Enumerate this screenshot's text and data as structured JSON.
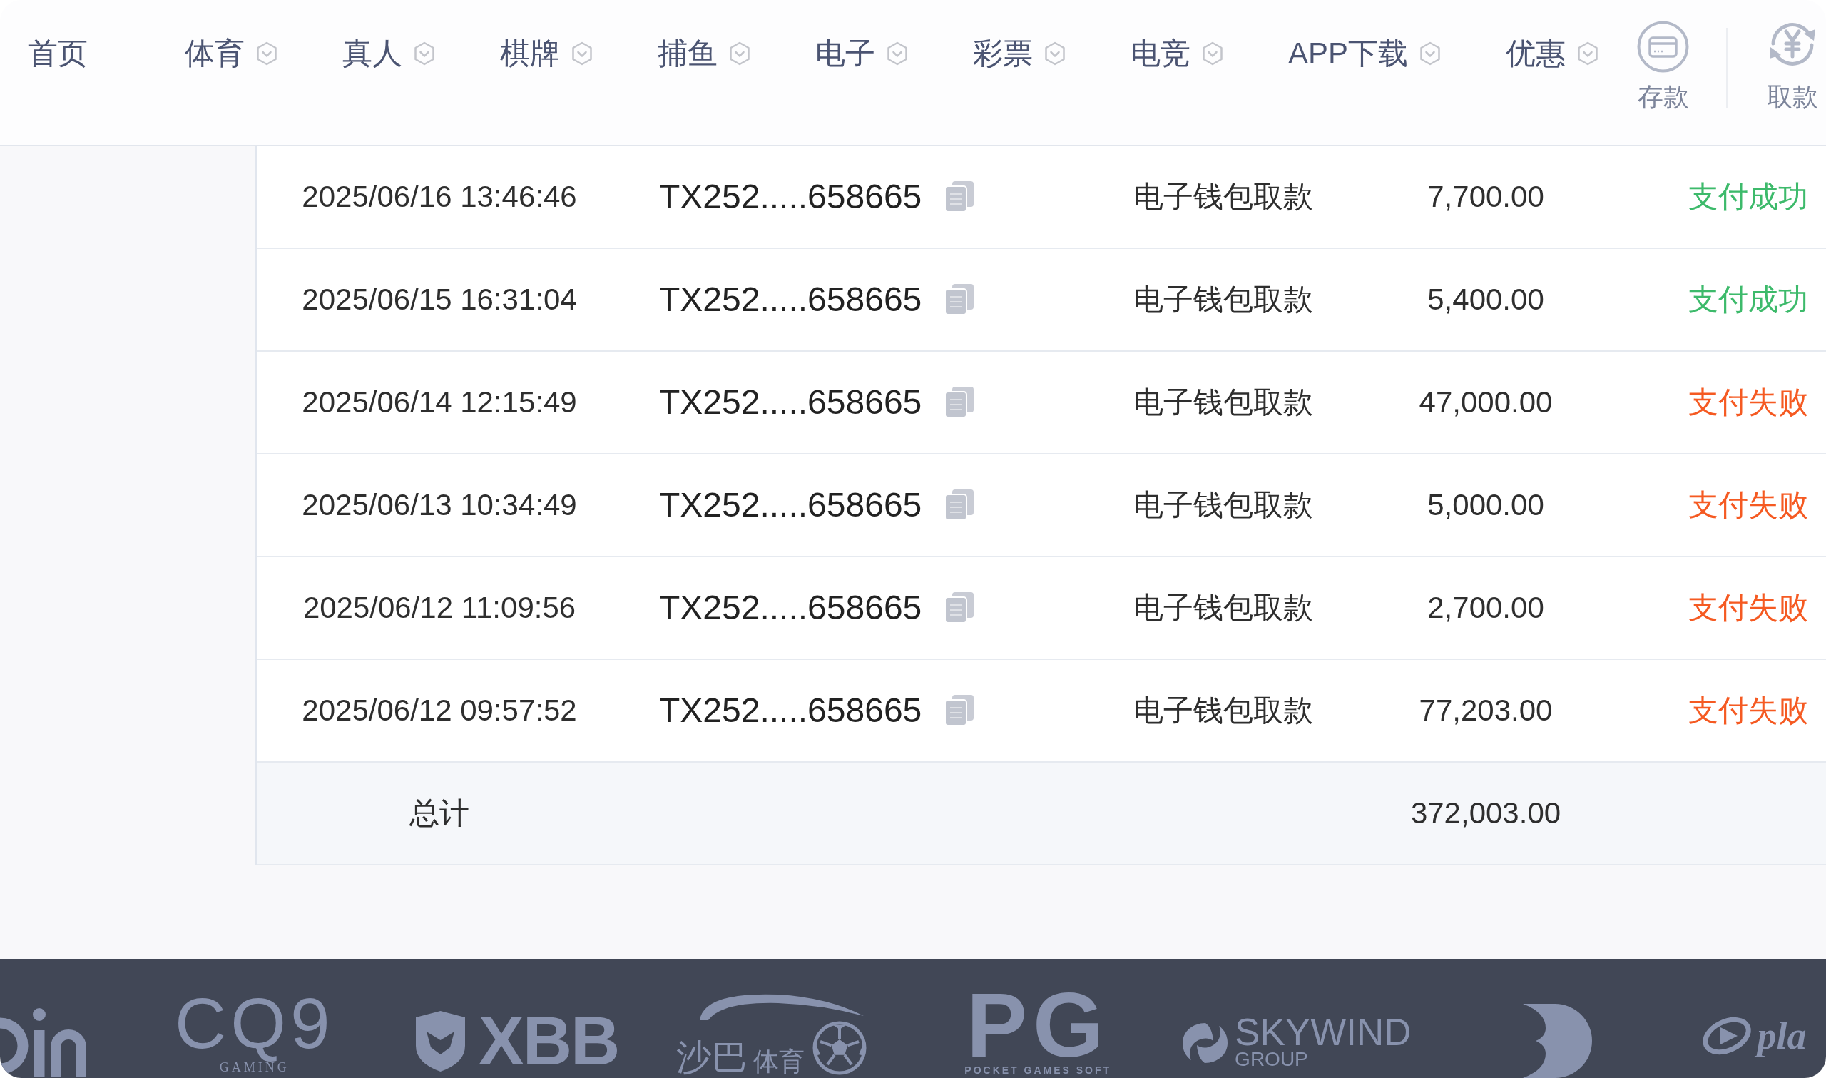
{
  "nav": {
    "items": [
      {
        "label": "首页",
        "dropdown": false
      },
      {
        "label": "体育",
        "dropdown": true
      },
      {
        "label": "真人",
        "dropdown": true
      },
      {
        "label": "棋牌",
        "dropdown": true
      },
      {
        "label": "捕鱼",
        "dropdown": true
      },
      {
        "label": "电子",
        "dropdown": true
      },
      {
        "label": "彩票",
        "dropdown": true
      },
      {
        "label": "电竞",
        "dropdown": true
      },
      {
        "label": "APP下载",
        "dropdown": true
      },
      {
        "label": "优惠",
        "dropdown": true
      }
    ],
    "actions": [
      {
        "kind": "deposit",
        "label": "存款"
      },
      {
        "kind": "withdraw",
        "label": "取款"
      }
    ]
  },
  "table": {
    "rows": [
      {
        "time": "2025/06/16 13:46:46",
        "order_id": "TX252.....658665",
        "type": "电子钱包取款",
        "amount": "7,700.00",
        "status": "支付成功",
        "color": "#3dba6b"
      },
      {
        "time": "2025/06/15 16:31:04",
        "order_id": "TX252.....658665",
        "type": "电子钱包取款",
        "amount": "5,400.00",
        "status": "支付成功",
        "color": "#3dba6b"
      },
      {
        "time": "2025/06/14 12:15:49",
        "order_id": "TX252.....658665",
        "type": "电子钱包取款",
        "amount": "47,000.00",
        "status": "支付失败",
        "color": "#f55a22"
      },
      {
        "time": "2025/06/13 10:34:49",
        "order_id": "TX252.....658665",
        "type": "电子钱包取款",
        "amount": "5,000.00",
        "status": "支付失败",
        "color": "#f55a22"
      },
      {
        "time": "2025/06/12 11:09:56",
        "order_id": "TX252.....658665",
        "type": "电子钱包取款",
        "amount": "2,700.00",
        "status": "支付失败",
        "color": "#f55a22"
      },
      {
        "time": "2025/06/12 09:57:52",
        "order_id": "TX252.....658665",
        "type": "电子钱包取款",
        "amount": "77,203.00",
        "status": "支付失败",
        "color": "#f55a22"
      }
    ],
    "total": {
      "label": "总计",
      "amount": "372,003.00"
    }
  },
  "footer": {
    "logos": [
      {
        "kind": "mark"
      },
      {
        "kind": "wordmark",
        "text": "CQ9",
        "subtext": "GAMING"
      },
      {
        "kind": "wordmark",
        "text": "XBB"
      },
      {
        "kind": "wordmark",
        "text": "沙巴",
        "subtext": "体育"
      },
      {
        "kind": "wordmark",
        "text": "PG",
        "subtext": "POCKET GAMES SOFT"
      },
      {
        "kind": "wordmark",
        "text": "SKYWIND",
        "subtext": "GROUP"
      },
      {
        "kind": "mark"
      },
      {
        "kind": "wordmark",
        "text": "pla"
      }
    ]
  }
}
